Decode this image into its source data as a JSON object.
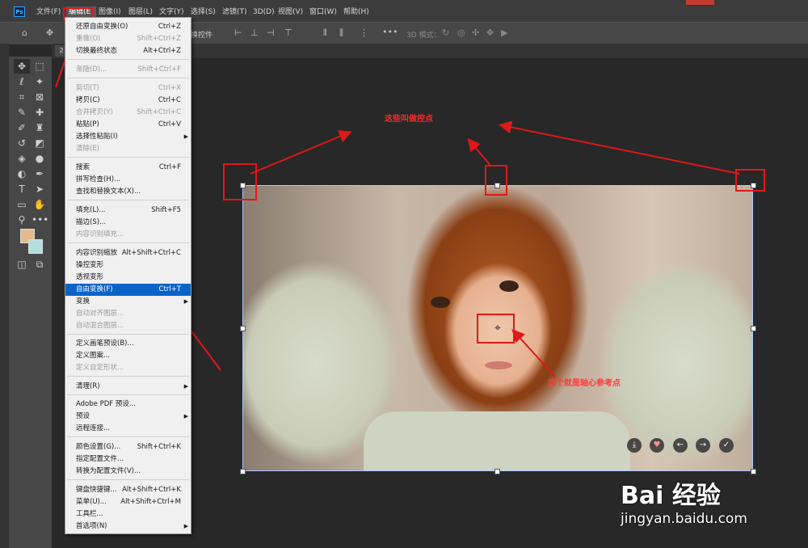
{
  "menubar": {
    "logo": "Ps",
    "items": [
      "文件(F)",
      "编辑(E)",
      "图像(I)",
      "图层(L)",
      "文字(Y)",
      "选择(S)",
      "滤镜(T)",
      "3D(D)",
      "视图(V)",
      "窗口(W)",
      "帮助(H)"
    ]
  },
  "optionsbar": {
    "transform_controls": "换控件",
    "mode_3d": "3D 模式："
  },
  "doc_tab": "2",
  "edit_menu": {
    "items": [
      {
        "label": "还原自由变换(O)",
        "shortcut": "Ctrl+Z"
      },
      {
        "label": "重做(O)",
        "shortcut": "Shift+Ctrl+Z"
      },
      {
        "label": "切换最终状态",
        "shortcut": "Alt+Ctrl+Z"
      },
      {
        "label": "渐隐(D)...",
        "shortcut": "Shift+Ctrl+F"
      },
      {
        "label": "剪切(T)",
        "shortcut": "Ctrl+X"
      },
      {
        "label": "拷贝(C)",
        "shortcut": "Ctrl+C"
      },
      {
        "label": "合并拷贝(Y)",
        "shortcut": "Shift+Ctrl+C"
      },
      {
        "label": "粘贴(P)",
        "shortcut": "Ctrl+V"
      },
      {
        "label": "选择性粘贴(I)",
        "shortcut": ""
      },
      {
        "label": "清除(E)",
        "shortcut": ""
      },
      {
        "label": "搜索",
        "shortcut": "Ctrl+F"
      },
      {
        "label": "拼写检查(H)...",
        "shortcut": ""
      },
      {
        "label": "查找和替换文本(X)...",
        "shortcut": ""
      },
      {
        "label": "填充(L)...",
        "shortcut": "Shift+F5"
      },
      {
        "label": "描边(S)...",
        "shortcut": ""
      },
      {
        "label": "内容识别填充...",
        "shortcut": ""
      },
      {
        "label": "内容识别缩放",
        "shortcut": "Alt+Shift+Ctrl+C"
      },
      {
        "label": "操控变形",
        "shortcut": ""
      },
      {
        "label": "透视变形",
        "shortcut": ""
      },
      {
        "label": "自由变换(F)",
        "shortcut": "Ctrl+T"
      },
      {
        "label": "变换",
        "shortcut": ""
      },
      {
        "label": "自动对齐图层...",
        "shortcut": ""
      },
      {
        "label": "自动混合图层...",
        "shortcut": ""
      },
      {
        "label": "定义画笔预设(B)...",
        "shortcut": ""
      },
      {
        "label": "定义图案...",
        "shortcut": ""
      },
      {
        "label": "定义自定形状...",
        "shortcut": ""
      },
      {
        "label": "清理(R)",
        "shortcut": ""
      },
      {
        "label": "Adobe PDF 预设...",
        "shortcut": ""
      },
      {
        "label": "预设",
        "shortcut": ""
      },
      {
        "label": "远程连接...",
        "shortcut": ""
      },
      {
        "label": "颜色设置(G)...",
        "shortcut": "Shift+Ctrl+K"
      },
      {
        "label": "指定配置文件...",
        "shortcut": ""
      },
      {
        "label": "转换为配置文件(V)...",
        "shortcut": ""
      },
      {
        "label": "键盘快捷键...",
        "shortcut": "Alt+Shift+Ctrl+K"
      },
      {
        "label": "菜单(U)...",
        "shortcut": "Alt+Shift+Ctrl+M"
      },
      {
        "label": "工具栏...",
        "shortcut": ""
      },
      {
        "label": "首选项(N)",
        "shortcut": ""
      }
    ]
  },
  "annotations": {
    "handles_label": "这些叫做控点",
    "pivot_label": "这个就是轴心参考点"
  },
  "watermark": {
    "brand": "Bai 经验",
    "url": "jingyan.baidu.com"
  },
  "colors": {
    "foreground": "#e6b98a",
    "background": "#b3dede",
    "highlight": "#0a64c8",
    "annotation": "#e01818"
  }
}
